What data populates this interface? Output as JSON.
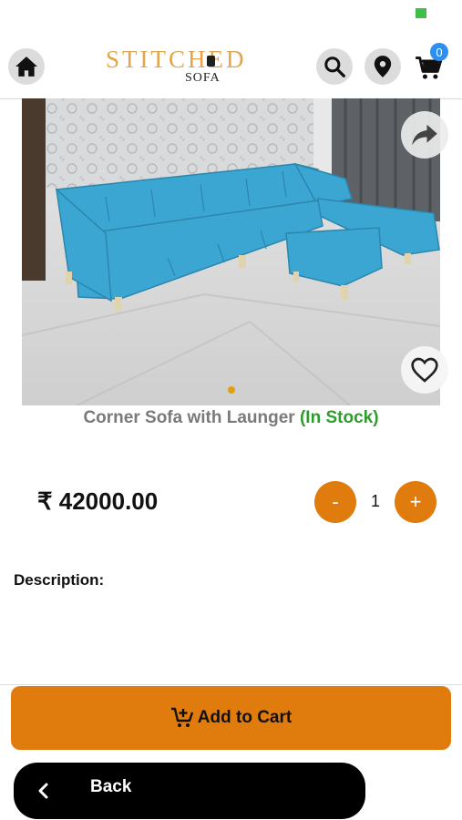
{
  "brand": {
    "name": "STITCHED",
    "sub": "SOFA"
  },
  "header": {
    "cart_count": "0"
  },
  "product": {
    "title": "Corner Sofa with Launger",
    "stock_status": "(In Stock)",
    "price": "₹ 42000.00",
    "quantity": "1",
    "minus_label": "-",
    "plus_label": "+",
    "description_label": "Description:"
  },
  "actions": {
    "add_to_cart": "Add to Cart",
    "back": "Back"
  },
  "colors": {
    "accent": "#e07b0d",
    "stock": "#2e9c2e",
    "badge": "#2d8ff0",
    "sofa": "#3ba6d1"
  },
  "icons": [
    "home-icon",
    "search-icon",
    "location-pin-icon",
    "cart-icon",
    "share-icon",
    "heart-icon",
    "add-cart-icon",
    "chevron-left-icon"
  ]
}
